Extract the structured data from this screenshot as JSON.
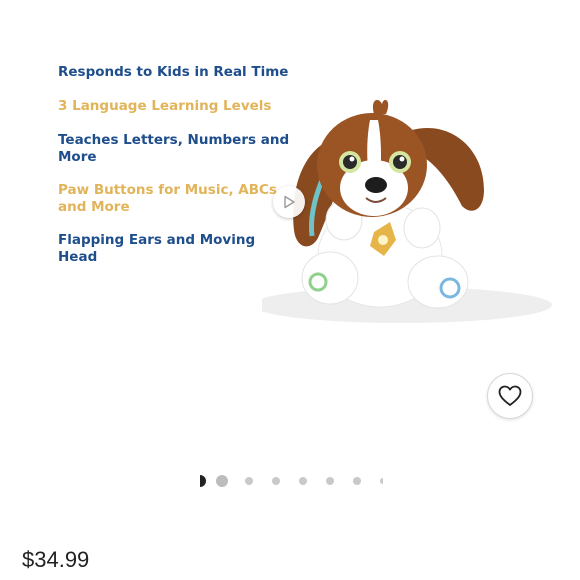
{
  "product": {
    "features": [
      {
        "text": "Responds to Kids in Real Time",
        "color": "#1f4e8c"
      },
      {
        "text": "3 Language Learning Levels",
        "color": "#e2b45a"
      },
      {
        "text": "Teaches Letters, Numbers and More",
        "color": "#1f4e8c"
      },
      {
        "text": "Paw Buttons for Music, ABCs and More",
        "color": "#e2b45a"
      },
      {
        "text": "Flapping Ears and Moving Head",
        "color": "#1f4e8c"
      }
    ],
    "price": "$34.99"
  },
  "gallery": {
    "dot_count": 8,
    "active_index": 0
  },
  "icons": {
    "play": "play-icon",
    "favorite": "heart-icon"
  }
}
